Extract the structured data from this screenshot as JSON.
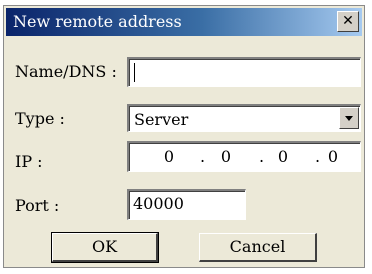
{
  "dialog": {
    "title": "New remote address",
    "close_glyph": "✕"
  },
  "form": {
    "name_label": "Name/DNS :",
    "name_value": "",
    "type_label": "Type :",
    "type_value": "Server",
    "ip_label": "IP :",
    "ip_octets": [
      "0",
      "0",
      "0",
      "0"
    ],
    "port_label": "Port :",
    "port_value": "40000"
  },
  "buttons": {
    "ok_label": "OK",
    "cancel_label": "Cancel"
  },
  "colors": {
    "titlebar_start": "#0a246a",
    "titlebar_end": "#a6caf0",
    "dialog_face": "#ece9d8"
  }
}
